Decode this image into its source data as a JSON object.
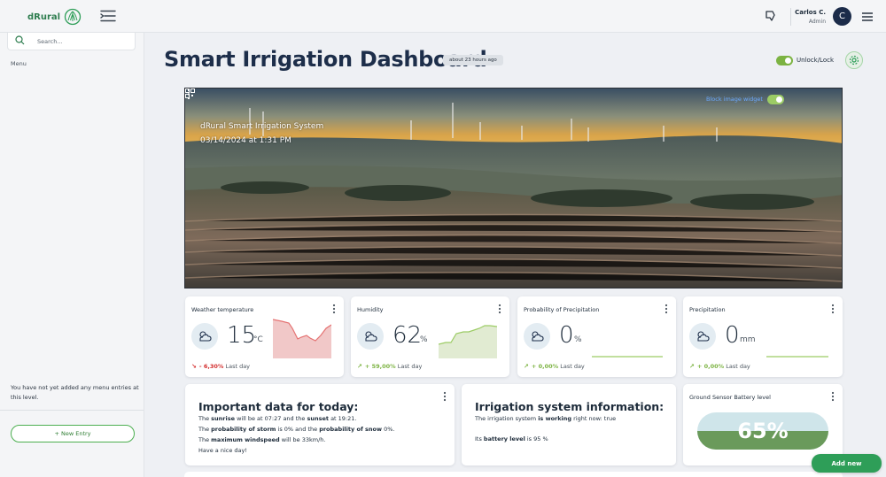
{
  "app": {
    "logo_text": "dRural",
    "logo_icon": "drural-logo-icon"
  },
  "topbar": {
    "user_name": "Carlos C.",
    "user_role": "Admin",
    "avatar_initial": "C"
  },
  "sidebar": {
    "search_placeholder": "Search...",
    "menu_heading": "Menu",
    "empty_note": "You have not yet added any menu entries at this level.",
    "new_entry_label": "+ New Entry"
  },
  "header": {
    "title": "Smart Irrigation Dashboard",
    "time_badge": "about 23 hours ago",
    "lock_label": "Unlock/Lock",
    "lock_on": true
  },
  "hero": {
    "title": "dRural Smart Irrigation System",
    "date": "03/14/2024 at 1:31 PM",
    "block_label": "Block image widget",
    "block_on": true
  },
  "cards": {
    "temperature": {
      "title": "Weather temperature",
      "value": "15",
      "unit": "°C",
      "delta": "- 6,30%",
      "delta_period": "Last day",
      "trend": "down",
      "accent": "#e57373"
    },
    "humidity": {
      "title": "Humidity",
      "value": "62",
      "unit": "%",
      "delta": "+ 59,00%",
      "delta_period": "Last day",
      "trend": "up",
      "accent": "#9ccc65"
    },
    "precip_prob": {
      "title": "Probability of Precipitation",
      "value": "0",
      "unit": "%",
      "delta": "+ 0,00%",
      "delta_period": "Last day",
      "trend": "up",
      "accent": "#9ccc65"
    },
    "precipitation": {
      "title": "Precipitation",
      "value": "0",
      "unit": "mm",
      "delta": "+ 0,00%",
      "delta_period": "Last day",
      "trend": "up",
      "accent": "#9ccc65"
    }
  },
  "important": {
    "title": "Important data for today:",
    "line1": {
      "a": "The ",
      "b": "sunrise",
      "c": " will be at 07:27 and the ",
      "d": "sunset",
      "e": " at 19:21."
    },
    "line2": {
      "a": "The ",
      "b": "probability of storm",
      "c": " is 0% and the ",
      "d": "probability of snow",
      "e": " 0%."
    },
    "line3": {
      "a": "The ",
      "b": "maximum windspeed",
      "c": " will be 33km/h."
    },
    "line4": "Have a nice day!"
  },
  "irrigation": {
    "title": "Irrigation system information:",
    "line1": {
      "a": "The irrigation system ",
      "b": "is working",
      "c": " right now: true"
    },
    "line2": {
      "a": "Its ",
      "b": "battery level",
      "c": " is 95 %"
    }
  },
  "battery": {
    "title": "Ground Sensor Battery level",
    "value_text": "65%",
    "level": 0.65
  },
  "actions": {
    "add_new_label": "Add new"
  },
  "colors": {
    "brand_green": "#2e9e58",
    "title_navy": "#1d2e4a",
    "negative": "#d32f2f",
    "positive": "#7cb342"
  }
}
